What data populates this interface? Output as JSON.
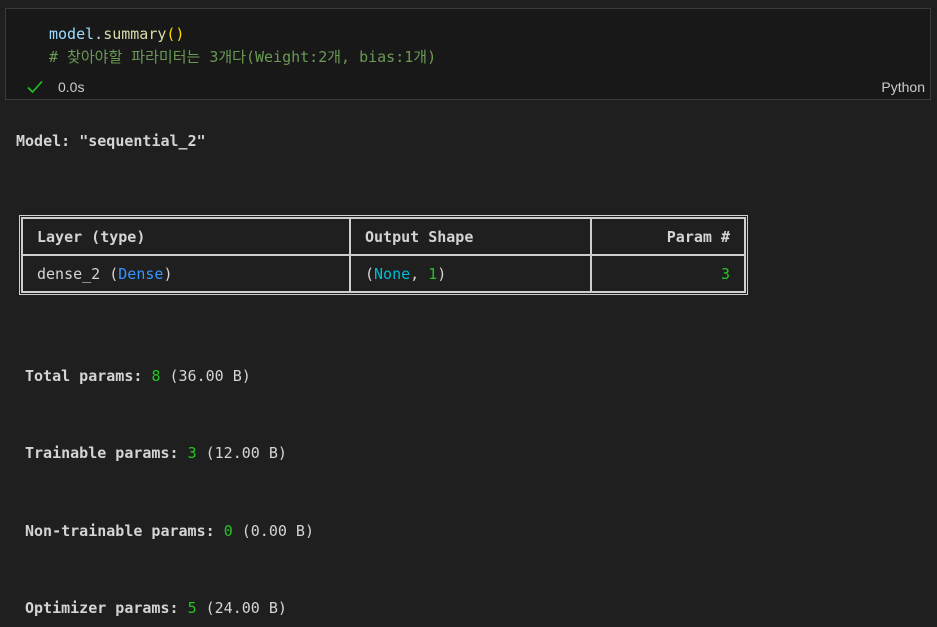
{
  "cell": {
    "code_var": "model",
    "code_dot": ".",
    "code_fn": "summary",
    "code_parens": "()",
    "code_comment": "# 찾아야할 파라미터는 3개다(Weight:2개, bias:1개)",
    "status_icon": "check-icon",
    "exec_time": "0.0s",
    "language": "Python"
  },
  "output": {
    "model_title": "Model: \"sequential_2\"",
    "table": {
      "headers": [
        "Layer (type)",
        "Output Shape",
        "Param #"
      ],
      "rows": [
        {
          "layer_name": "dense_2",
          "layer_open": " (",
          "layer_type": "Dense",
          "layer_close": ")",
          "shape_open": "(",
          "shape_none": "None",
          "shape_sep": ", ",
          "shape_dim": "1",
          "shape_close": ")",
          "params": "3"
        }
      ]
    },
    "params": [
      {
        "label": "Total params:",
        "count": "8",
        "size": "(36.00 B)"
      },
      {
        "label": "Trainable params:",
        "count": "3",
        "size": "(12.00 B)"
      },
      {
        "label": "Non-trainable params:",
        "count": "0",
        "size": "(0.00 B)"
      },
      {
        "label": "Optimizer params:",
        "count": "5",
        "size": "(24.00 B)"
      }
    ]
  },
  "colors": {
    "background": "#1f1f1f",
    "keyword_blue": "#3794ff",
    "value_green": "#23c523",
    "comment_green": "#6a9955",
    "check_green": "#23c523"
  }
}
